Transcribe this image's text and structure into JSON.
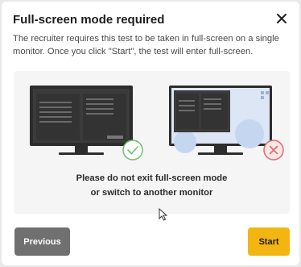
{
  "modal": {
    "title": "Full-screen mode required",
    "description": "The recruiter requires this test to be taken in full-screen on a single monitor. Once you click \"Start\", the test will enter full-screen.",
    "note_line1": "Please do not exit full-screen mode",
    "note_line2": "or switch to another monitor"
  },
  "buttons": {
    "previous": "Previous",
    "start": "Start"
  },
  "icons": {
    "close": "close-icon",
    "allowed": "check-circle-icon",
    "not_allowed": "x-circle-icon",
    "cursor": "mouse-pointer-icon"
  },
  "colors": {
    "accent": "#f3b511",
    "secondary_button": "#707070",
    "success": "#6cc36c",
    "error": "#e06a6a",
    "monitor_screen": "#2d2d2d"
  }
}
